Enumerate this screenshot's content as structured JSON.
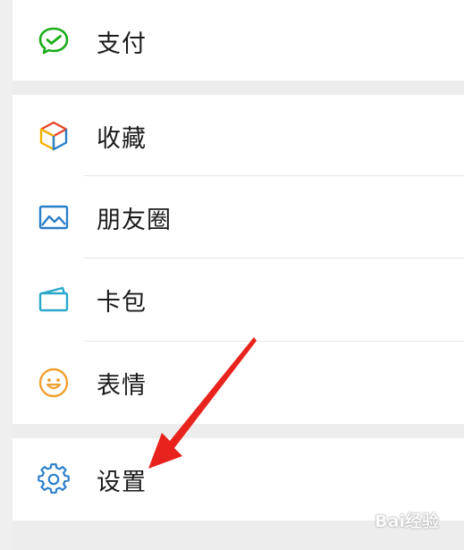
{
  "menu": {
    "items": [
      {
        "label": "支付",
        "icon": "wechat-pay-icon"
      },
      {
        "label": "收藏",
        "icon": "favorites-cube-icon"
      },
      {
        "label": "朋友圈",
        "icon": "moments-image-icon"
      },
      {
        "label": "卡包",
        "icon": "card-wallet-icon"
      },
      {
        "label": "表情",
        "icon": "smiley-face-icon"
      },
      {
        "label": "设置",
        "icon": "gear-icon"
      }
    ]
  },
  "colors": {
    "pay_green": "#1aad19",
    "annotation_red": "#e8231d",
    "gear_blue": "#2a7fc9",
    "smiley_orange": "#f0a030"
  },
  "watermark": {
    "text": "Bai经验"
  }
}
